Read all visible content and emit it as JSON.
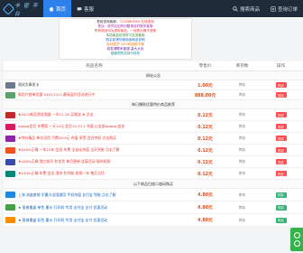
{
  "nav": {
    "logo_text": "卡 密 平 台",
    "items": [
      {
        "label": "首页",
        "active": true
      },
      {
        "label": "客服",
        "active": false
      },
      {
        "label": "搜索商品",
        "active": false
      },
      {
        "label": "查询订单",
        "active": false
      }
    ]
  },
  "notice": {
    "line1_prefix": "售前咨询客服：",
    "line1_value": "7225687863 在线咨询",
    "line2": "售后：收货后如有问题请及时联系客服",
    "line3": "所有商品均为虚拟商品，一经售出概不退换",
    "line4": "本站商品仅供学习交流使用",
    "line5": "购买前请仔细阅读商品说明",
    "line6": "自动发货 24小时自助下单",
    "line7": "批发请联系客服 量大从优",
    "line8": "感谢您的支持与信任"
  },
  "table": {
    "headers": [
      "商品名称",
      "零售价",
      "库存数",
      "操作"
    ],
    "sections": [
      {
        "title": "网站公告",
        "rows": [
          {
            "name": "测试文章发卡",
            "name_color": "#333333",
            "thumb": "#6b7a8f",
            "price": "1.00元",
            "stock": "库存",
            "btn": "购买",
            "btn_color": "red"
          },
          {
            "name": "新用户首单优惠 XXX12312 最高返利活动进行中",
            "name_color": "#e53935",
            "thumb": "#5aa469",
            "price": "888.00元",
            "stock": "库存",
            "btn": "购买",
            "btn_color": "red"
          }
        ]
      },
      {
        "title": "每日爆款优惠特价商品推荐",
        "rows": [
          {
            "name": "★2021新品首发限量 一年12.28 买就送 ★ 点击",
            "name_color": "#e53935",
            "thumb": "#c62828",
            "price": "0.12元",
            "stock": "库存",
            "btn": "购买",
            "btn_color": "red"
          },
          {
            "name": "qqqqq会员 年费版 一天10元 会员10.33 1 充值 以全部qqqqq 加油",
            "name_color": "#e53935",
            "thumb": "#d81b60",
            "price": "0.12元",
            "stock": "库存",
            "btn": "购买",
            "btn_color": "red"
          },
          {
            "name": "★特价精品 单次试用 月费28.9元 充值 享受 会员特权 点击购买",
            "name_color": "#e53935",
            "thumb": "#8e24aa",
            "price": "0.12元",
            "stock": "库存",
            "btn": "购买",
            "btn_color": "red"
          },
          {
            "name": "★100%正确 一年12年 会员 年费 全自动充值 当天到账 点击了解",
            "name_color": "#e53935",
            "thumb": "#f4511e",
            "price": "0.12元",
            "stock": "库存",
            "btn": "购买",
            "btn_color": "red"
          },
          {
            "name": "★100%正确 独立账号 秒发货 每月更新 优惠活动 限时抢购",
            "name_color": "#e53935",
            "thumb": "#3949ab",
            "price": "0.12元",
            "stock": "库存",
            "btn": "购买",
            "btn_color": "red"
          },
          {
            "name": "★100%正确 年费 会员 直充 秒到账 质保一年 售后无忧",
            "name_color": "#e53935",
            "thumb": "#00897b",
            "price": "0.12元",
            "stock": "库存",
            "btn": "购买",
            "btn_color": "red"
          }
        ]
      },
      {
        "title": "以下商品扫描二维码购买",
        "rows": [
          {
            "name": "上海 流量套餐 步赢卡全国通用 手机充值 支付宝 到账 点击了解",
            "name_color": "#1565c0",
            "thumb": "#1e88e5",
            "price": "4.80元",
            "stock": "库存",
            "btn": "购买",
            "btn_color": "green"
          },
          {
            "name": "★ 惠普墨盒 单色 墨水 打印机 专用 支付宝 支付 优惠活动",
            "name_color": "#1565c0",
            "thumb": "#43a047",
            "price": "4.80元",
            "stock": "库存",
            "btn": "购买",
            "btn_color": "green"
          },
          {
            "name": "★ 惠普墨盒 彩色 墨水 打印机 专用 支付宝 支付 优惠活动",
            "name_color": "#1565c0",
            "thumb": "#fb8c00",
            "price": "4.80元",
            "stock": "库存",
            "btn": "购买",
            "btn_color": "green"
          }
        ]
      }
    ]
  },
  "colors": {
    "nav_bg": "#1f2b3b",
    "nav_active": "#2d81ea",
    "price": "#e64a19",
    "float": "#34b34a"
  }
}
